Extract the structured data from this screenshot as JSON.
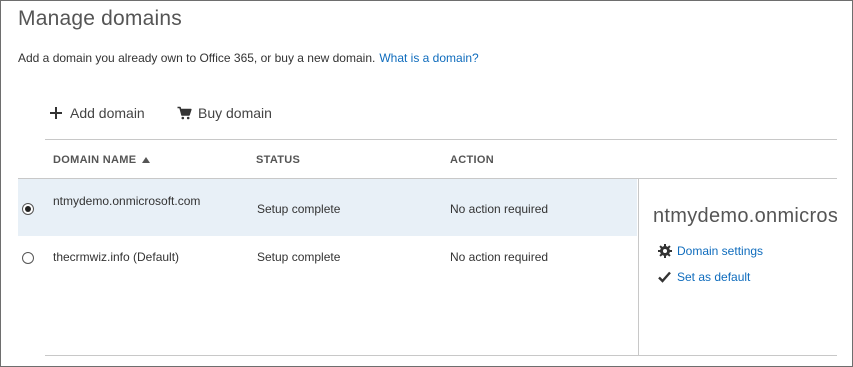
{
  "page": {
    "title": "Manage domains",
    "intro_text": "Add a domain you already own to Office 365, or buy a new domain.",
    "intro_link": "What is a domain?"
  },
  "commands": {
    "add_domain": "Add domain",
    "buy_domain": "Buy domain"
  },
  "table": {
    "columns": {
      "name": "DOMAIN NAME",
      "status": "STATUS",
      "action": "ACTION"
    },
    "rows": [
      {
        "name": "ntmydemo.onmicrosoft.com",
        "status": "Setup complete",
        "action": "No action required",
        "selected": true
      },
      {
        "name": "thecrmwiz.info (Default)",
        "status": "Setup complete",
        "action": "No action required",
        "selected": false
      }
    ]
  },
  "detail": {
    "title": "ntmydemo.onmicrosoft.com",
    "links": {
      "settings": "Domain settings",
      "set_default": "Set as default"
    }
  },
  "icons": {
    "add": "plus-icon",
    "buy": "cart-icon",
    "sort": "sort-asc-icon",
    "settings": "gear-icon",
    "set_default": "check-icon"
  },
  "colors": {
    "link": "#0f6cbd",
    "selected_row": "#e8f0f7",
    "border": "#c8c8c8"
  }
}
